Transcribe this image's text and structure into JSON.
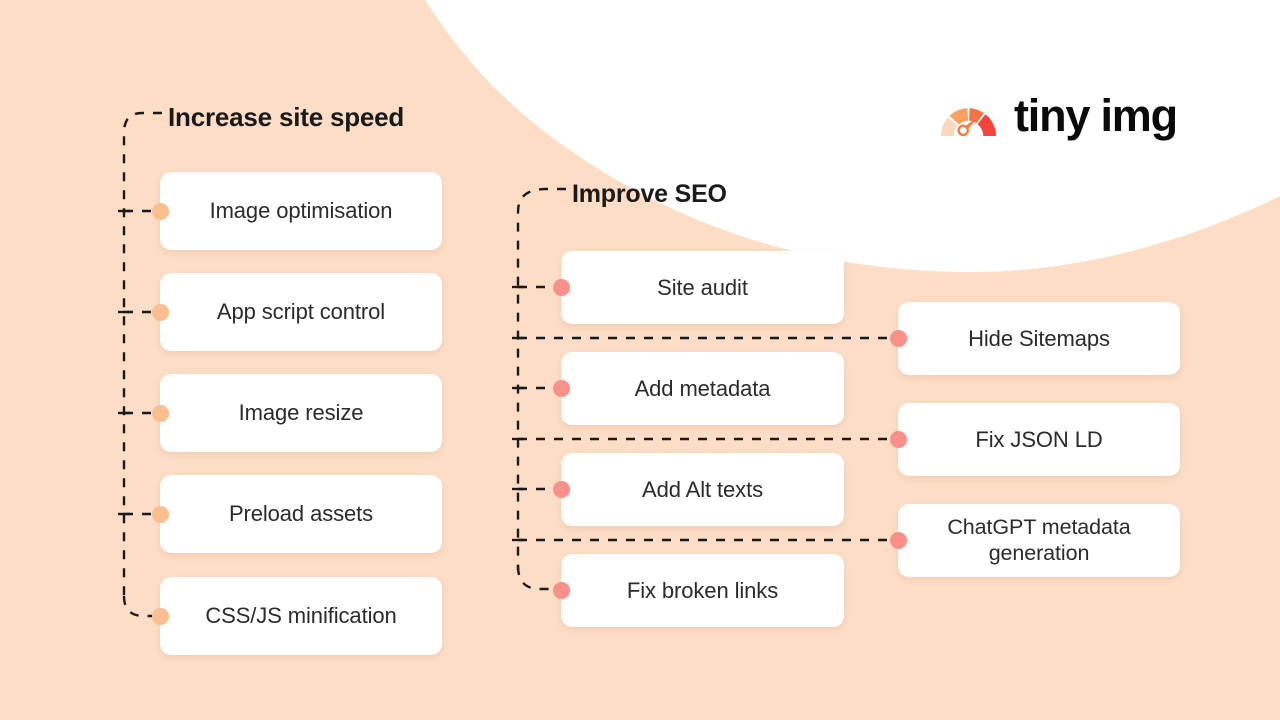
{
  "brand": {
    "wordmark": "tiny img",
    "gauge_icon": "speedometer-gauge-icon",
    "gauge_colors": [
      "#FDD7BE",
      "#FB9F63",
      "#FB7044",
      "#F6443C"
    ],
    "needle_color": "#F77B3C"
  },
  "theme": {
    "background": "#FDDDC6",
    "swoosh": "#FFFFFF",
    "card_background": "#FFFFFF",
    "text": "#2B2B2B",
    "heading_text": "#1A1A1A",
    "dot_peach": "#FBBE8E",
    "dot_salmon": "#FB908A",
    "connector": "#1A1A1A"
  },
  "branches": [
    {
      "id": "increase-site-speed",
      "heading": "Increase site speed",
      "dot_color": "peach",
      "items": [
        {
          "label": "Image optimisation"
        },
        {
          "label": "App script control"
        },
        {
          "label": "Image resize"
        },
        {
          "label": "Preload assets"
        },
        {
          "label": "CSS/JS minification"
        }
      ]
    },
    {
      "id": "improve-seo",
      "heading": "Improve SEO",
      "dot_color": "salmon",
      "items": [
        {
          "label": "Site audit"
        },
        {
          "label": "Add metadata"
        },
        {
          "label": "Add Alt texts"
        },
        {
          "label": "Fix broken links"
        }
      ],
      "secondary_items": [
        {
          "label": "Hide Sitemaps"
        },
        {
          "label": "Fix JSON LD"
        },
        {
          "label": "ChatGPT metadata generation",
          "lines": [
            "ChatGPT metadata",
            "generation"
          ]
        }
      ]
    }
  ]
}
